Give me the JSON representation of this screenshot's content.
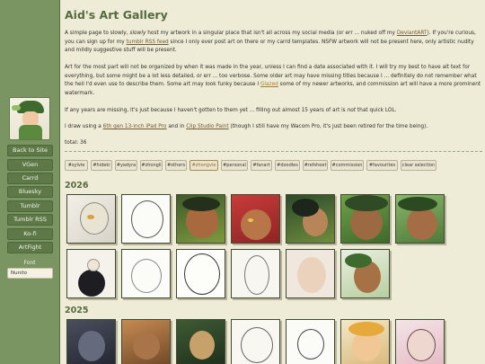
{
  "sidebar": {
    "nav": [
      "Back to Site",
      "VGen",
      "Carrd",
      "Bluesky",
      "Tumblr",
      "Tumblr RSS",
      "Ko-fi",
      "ArtFight"
    ],
    "font_label": "Font",
    "font_value": "Nunito"
  },
  "page": {
    "title": "Aid's Art Gallery",
    "p1": {
      "a": "A simple page to slowly, ",
      "b": "slowly",
      "c": " host my artwork in a singular place that isn't all across my social media (or err ... nuked off my ",
      "d": "DeviantART",
      "e": "). If you're curious, you can sign up for my ",
      "f": "tumblr RSS feed",
      "g": " since I only ever post art on there or my carrd templates. NSFW artwork will not be present here, only artistic nudity and mildly suggestive stuff will be present."
    },
    "p2": {
      "a": "Art for the most part will not be organized by when it was made in the year, unless I can find a date associated with it. I will try my best to have alt text for everything, but some might be a lot less detailed, or err ... too verbose. Some older art may have missing titles because I ... definitely do not remember what the hell I'd even use to describe them. Some art may look funky because I ",
      "b": "Glazed",
      "c": " some of my newer artworks, and commission art will have a more prominent watermark."
    },
    "p3": {
      "a": "If any years are missing, it's just because I haven't gotten to them yet ... filling out almost 15 years of art is ",
      "b": "not",
      "c": " that quick LOL."
    },
    "p4": {
      "a": "I draw using a ",
      "b": "6th gen 13-inch iPad Pro",
      "c": " and in ",
      "d": "Clip Studio Paint",
      "e": " (though I still have my Wacom Pro, it's just been retired for the time being)."
    },
    "total": "total: 36"
  },
  "tags": [
    "#sylvie",
    "#hideki",
    "#yadyra",
    "#zhongli",
    "#others",
    "#zhongvie",
    "#personal",
    "#fanart",
    "#doodles",
    "#refsheet",
    "#commission",
    "#favourites",
    "clear selection"
  ],
  "active_tag": "#zhongvie",
  "years": [
    "2026",
    "2025"
  ],
  "colors": {
    "accent": "#556b3f",
    "sidebar": "#7a9462",
    "page_bg": "#eeebd7",
    "link": "#6e5a35",
    "highlight": "#a3802e"
  }
}
